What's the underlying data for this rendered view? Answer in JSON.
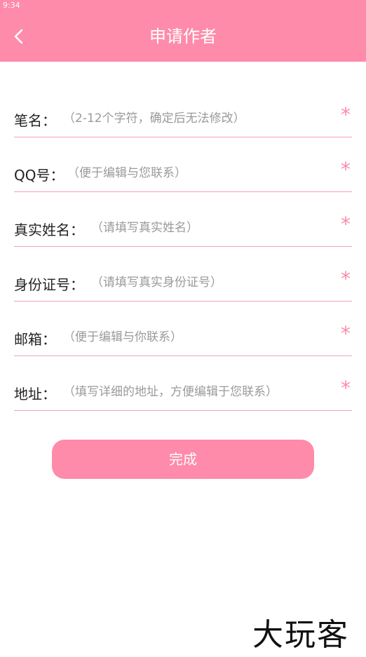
{
  "status_bar": {
    "time": "9:34"
  },
  "header": {
    "title": "申请作者",
    "back_icon": "chevron-left-icon"
  },
  "form": {
    "fields": [
      {
        "label": "笔名：",
        "placeholder": "（2-12个字符，确定后无法修改）",
        "required": "*"
      },
      {
        "label": "QQ号：",
        "placeholder": "（便于编辑与您联系）",
        "required": "*"
      },
      {
        "label": "真实姓名：",
        "placeholder": "（请填写真实姓名）",
        "required": "*"
      },
      {
        "label": "身份证号：",
        "placeholder": "（请填写真实身份证号）",
        "required": "*"
      },
      {
        "label": "邮箱：",
        "placeholder": "（便于编辑与你联系）",
        "required": "*"
      },
      {
        "label": "地址：",
        "placeholder": "（填写详细的地址，方便编辑于您联系）",
        "required": "*"
      }
    ]
  },
  "submit_label": "完成",
  "watermark": "大玩客",
  "colors": {
    "accent": "#fe8ba9",
    "divider": "#f3a0b8",
    "label_text": "#222222",
    "placeholder_text": "#9a9a9a"
  }
}
